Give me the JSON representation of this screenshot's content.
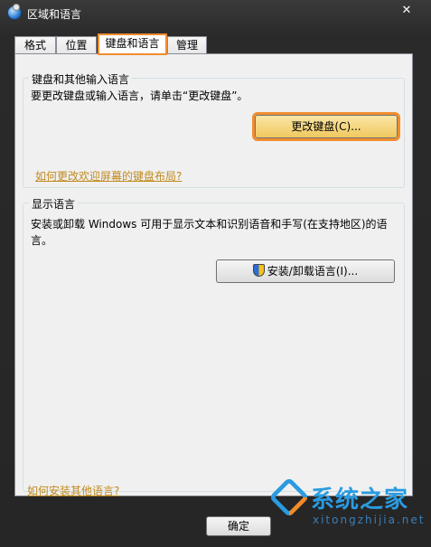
{
  "window": {
    "title": "区域和语言",
    "close_glyph": "✕"
  },
  "tabs": [
    {
      "label": "格式",
      "selected": false
    },
    {
      "label": "位置",
      "selected": false
    },
    {
      "label": "键盘和语言",
      "selected": true
    },
    {
      "label": "管理",
      "selected": false
    }
  ],
  "keyboard_group": {
    "title": "键盘和其他输入语言",
    "description": "要更改键盘或输入语言，请单击“更改键盘”。",
    "change_button_label": "更改键盘(C)...",
    "link": "如何更改欢迎屏幕的键盘布局?"
  },
  "display_group": {
    "title": "显示语言",
    "description": "安装或卸载 Windows 可用于显示文本和识别语音和手写(在支持地区)的语言。",
    "install_button_label": "安装/卸载语言(I)..."
  },
  "footer": {
    "link": "如何安装其他语言?",
    "ok_button_label": "确定"
  },
  "watermark": {
    "text": "系统之家",
    "url": "xitongzhijia.net"
  },
  "colors": {
    "highlight": "#f18d2f",
    "link": "#c08a20"
  }
}
